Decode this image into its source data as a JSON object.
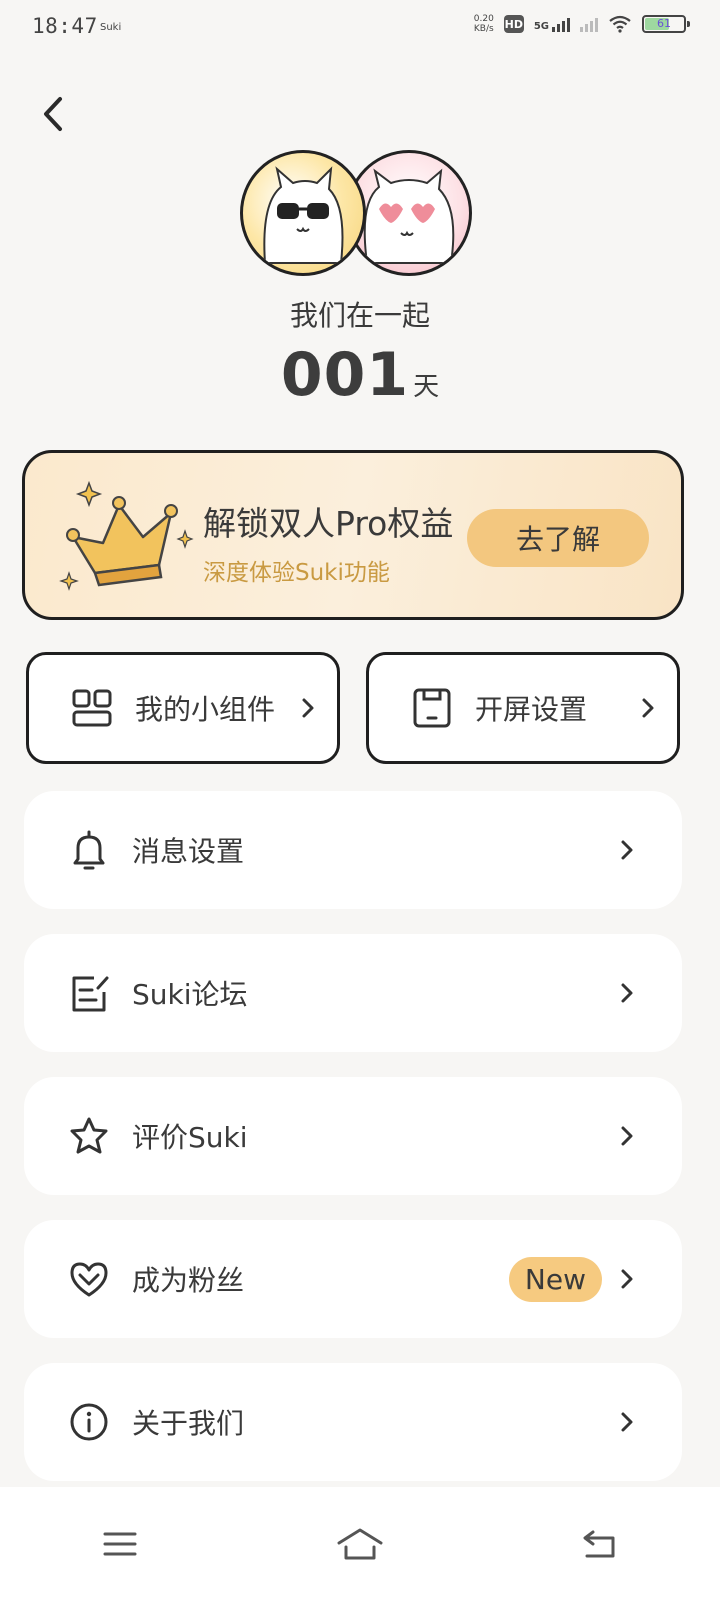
{
  "status": {
    "time": "18:47",
    "app_name": "Suki",
    "net_speed_value": "0.20",
    "net_speed_unit": "KB/s",
    "hd": "HD",
    "network": "5G",
    "battery": "61"
  },
  "header": {
    "together_label": "我们在一起",
    "days_count": "001",
    "days_unit": "天"
  },
  "pro": {
    "title": "解锁双人Pro权益",
    "subtitle": "深度体验Suki功能",
    "button": "去了解"
  },
  "shortcuts": {
    "widgets": "我的小组件",
    "splash": "开屏设置"
  },
  "menu": {
    "notifications": "消息设置",
    "forum": "Suki论坛",
    "rate": "评价Suki",
    "fan": "成为粉丝",
    "fan_badge": "New",
    "about": "关于我们"
  },
  "icons": {
    "back": "back-icon",
    "bell": "bell-icon",
    "forum": "edit-note-icon",
    "star": "star-icon",
    "heart": "heart-icon",
    "info": "info-icon",
    "widgets": "widgets-icon",
    "splash": "phone-screen-icon"
  },
  "colors": {
    "background": "#f7f6f4",
    "pro_card": "#fbe9cd",
    "accent": "#f3c77f",
    "pro_subtitle": "#c99a42"
  }
}
